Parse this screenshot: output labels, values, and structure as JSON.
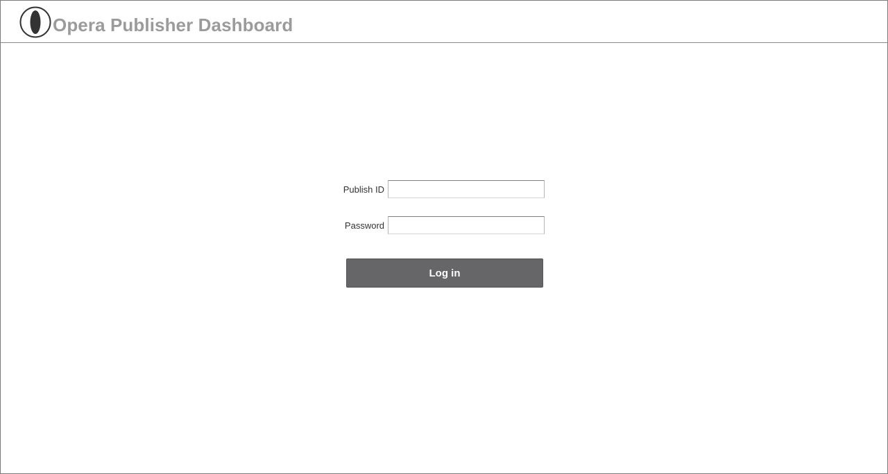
{
  "header": {
    "title": "Opera Publisher Dashboard",
    "logo_icon": "opera-logo-icon",
    "title_color": "#9b9b9b"
  },
  "login": {
    "publish_id_label": "Publish ID",
    "publish_id_value": "",
    "password_label": "Password",
    "password_value": "",
    "submit_label": "Log in",
    "button_color": "#666567"
  }
}
